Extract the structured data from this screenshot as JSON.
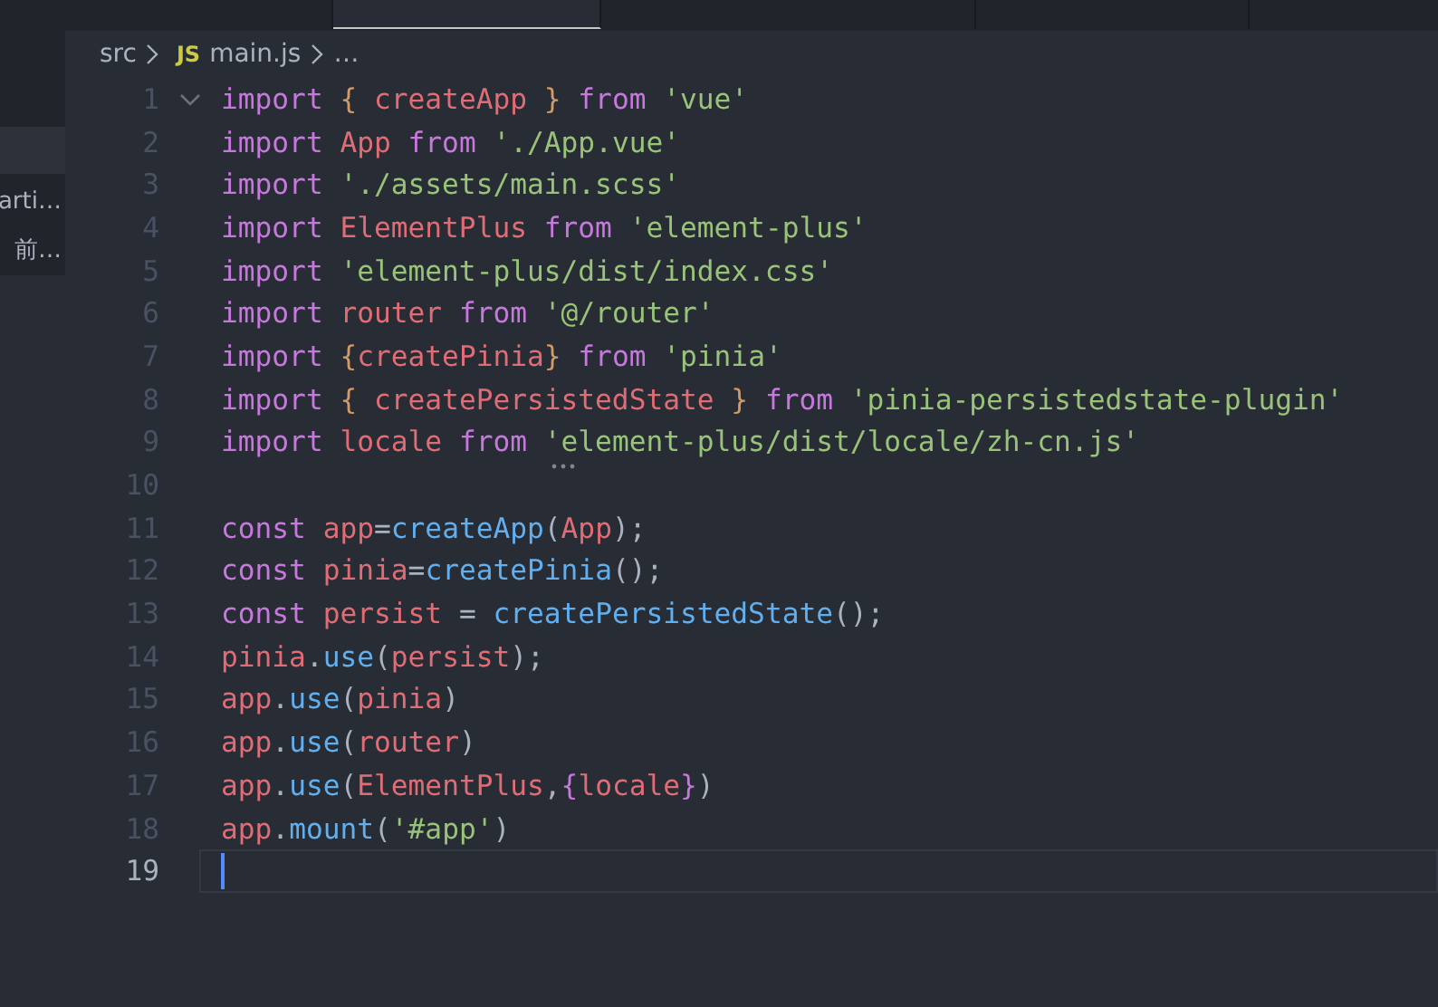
{
  "tabs": [
    {
      "selected": false
    },
    {
      "selected": true
    },
    {
      "selected": false
    },
    {
      "selected": false
    }
  ],
  "sidebar": {
    "items": [
      {
        "selected": true
      },
      {
        "label": "arti…",
        "selected": false
      },
      {
        "label": "前…",
        "selected": false
      }
    ]
  },
  "breadcrumb": {
    "folder": "src",
    "file_icon": "JS",
    "file": "main.js",
    "more": "…"
  },
  "editor": {
    "lines": [
      {
        "number": "1",
        "fold": true,
        "cursor": false,
        "tokens": [
          {
            "kind": "kw",
            "text": "import "
          },
          {
            "kind": "brace",
            "text": "{ "
          },
          {
            "kind": "var",
            "text": "createApp "
          },
          {
            "kind": "brace",
            "text": "} "
          },
          {
            "kind": "kw",
            "text": "from "
          },
          {
            "kind": "str",
            "text": "'vue'"
          }
        ]
      },
      {
        "number": "2",
        "fold": false,
        "cursor": false,
        "tokens": [
          {
            "kind": "kw",
            "text": "import "
          },
          {
            "kind": "var",
            "text": "App "
          },
          {
            "kind": "kw",
            "text": "from "
          },
          {
            "kind": "str",
            "text": "'./App.vue'"
          }
        ]
      },
      {
        "number": "3",
        "fold": false,
        "cursor": false,
        "tokens": [
          {
            "kind": "kw",
            "text": "import "
          },
          {
            "kind": "str",
            "text": "'./assets/main.scss'"
          }
        ]
      },
      {
        "number": "4",
        "fold": false,
        "cursor": false,
        "tokens": [
          {
            "kind": "kw",
            "text": "import "
          },
          {
            "kind": "var",
            "text": "ElementPlus "
          },
          {
            "kind": "kw",
            "text": "from "
          },
          {
            "kind": "str",
            "text": "'element-plus'"
          }
        ]
      },
      {
        "number": "5",
        "fold": false,
        "cursor": false,
        "tokens": [
          {
            "kind": "kw",
            "text": "import "
          },
          {
            "kind": "str",
            "text": "'element-plus/dist/index.css'"
          }
        ]
      },
      {
        "number": "6",
        "fold": false,
        "cursor": false,
        "tokens": [
          {
            "kind": "kw",
            "text": "import "
          },
          {
            "kind": "var",
            "text": "router "
          },
          {
            "kind": "kw",
            "text": "from "
          },
          {
            "kind": "str",
            "text": "'@/router'"
          }
        ]
      },
      {
        "number": "7",
        "fold": false,
        "cursor": false,
        "tokens": [
          {
            "kind": "kw",
            "text": "import "
          },
          {
            "kind": "brace",
            "text": "{"
          },
          {
            "kind": "var",
            "text": "createPinia"
          },
          {
            "kind": "brace",
            "text": "} "
          },
          {
            "kind": "kw",
            "text": "from "
          },
          {
            "kind": "str",
            "text": "'pinia'"
          }
        ]
      },
      {
        "number": "8",
        "fold": false,
        "cursor": false,
        "tokens": [
          {
            "kind": "kw",
            "text": "import "
          },
          {
            "kind": "brace",
            "text": "{ "
          },
          {
            "kind": "var",
            "text": "createPersistedState "
          },
          {
            "kind": "brace",
            "text": "} "
          },
          {
            "kind": "kw",
            "text": "from "
          },
          {
            "kind": "str",
            "text": "'pinia-persistedstate-plugin'"
          }
        ]
      },
      {
        "number": "9",
        "fold": false,
        "cursor": false,
        "tokens": [
          {
            "kind": "kw",
            "text": "import "
          },
          {
            "kind": "var",
            "text": "locale "
          },
          {
            "kind": "kw",
            "text": "from "
          },
          {
            "kind": "str",
            "text": "'element-plus/dist/locale/zh-cn.js'"
          }
        ]
      },
      {
        "number": "10",
        "fold": false,
        "cursor": false
      },
      {
        "number": "11",
        "fold": false,
        "cursor": false,
        "tokens": [
          {
            "kind": "kw",
            "text": "const "
          },
          {
            "kind": "var",
            "text": "app"
          },
          {
            "kind": "plain",
            "text": "="
          },
          {
            "kind": "fn",
            "text": "createApp"
          },
          {
            "kind": "plain",
            "text": "("
          },
          {
            "kind": "var",
            "text": "App"
          },
          {
            "kind": "plain",
            "text": ");"
          }
        ]
      },
      {
        "number": "12",
        "fold": false,
        "cursor": false,
        "tokens": [
          {
            "kind": "kw",
            "text": "const "
          },
          {
            "kind": "var",
            "text": "pinia"
          },
          {
            "kind": "plain",
            "text": "="
          },
          {
            "kind": "fn",
            "text": "createPinia"
          },
          {
            "kind": "plain",
            "text": "();"
          }
        ]
      },
      {
        "number": "13",
        "fold": false,
        "cursor": false,
        "tokens": [
          {
            "kind": "kw",
            "text": "const "
          },
          {
            "kind": "var",
            "text": "persist "
          },
          {
            "kind": "plain",
            "text": "= "
          },
          {
            "kind": "fn",
            "text": "createPersistedState"
          },
          {
            "kind": "plain",
            "text": "();"
          }
        ]
      },
      {
        "number": "14",
        "fold": false,
        "cursor": false,
        "tokens": [
          {
            "kind": "var",
            "text": "pinia"
          },
          {
            "kind": "plain",
            "text": "."
          },
          {
            "kind": "fn",
            "text": "use"
          },
          {
            "kind": "plain",
            "text": "("
          },
          {
            "kind": "var",
            "text": "persist"
          },
          {
            "kind": "plain",
            "text": ");"
          }
        ]
      },
      {
        "number": "15",
        "fold": false,
        "cursor": false,
        "tokens": [
          {
            "kind": "var",
            "text": "app"
          },
          {
            "kind": "plain",
            "text": "."
          },
          {
            "kind": "fn",
            "text": "use"
          },
          {
            "kind": "plain",
            "text": "("
          },
          {
            "kind": "var",
            "text": "pinia"
          },
          {
            "kind": "plain",
            "text": ")"
          }
        ]
      },
      {
        "number": "16",
        "fold": false,
        "cursor": false,
        "tokens": [
          {
            "kind": "var",
            "text": "app"
          },
          {
            "kind": "plain",
            "text": "."
          },
          {
            "kind": "fn",
            "text": "use"
          },
          {
            "kind": "plain",
            "text": "("
          },
          {
            "kind": "var",
            "text": "router"
          },
          {
            "kind": "plain",
            "text": ")"
          }
        ]
      },
      {
        "number": "17",
        "fold": false,
        "cursor": false,
        "tokens": [
          {
            "kind": "var",
            "text": "app"
          },
          {
            "kind": "plain",
            "text": "."
          },
          {
            "kind": "fn",
            "text": "use"
          },
          {
            "kind": "plain",
            "text": "("
          },
          {
            "kind": "var",
            "text": "ElementPlus"
          },
          {
            "kind": "plain",
            "text": ","
          },
          {
            "kind": "brace2",
            "text": "{"
          },
          {
            "kind": "var",
            "text": "locale"
          },
          {
            "kind": "brace2",
            "text": "}"
          },
          {
            "kind": "plain",
            "text": ")"
          }
        ]
      },
      {
        "number": "18",
        "fold": false,
        "cursor": false,
        "tokens": [
          {
            "kind": "var",
            "text": "app"
          },
          {
            "kind": "plain",
            "text": "."
          },
          {
            "kind": "fn",
            "text": "mount"
          },
          {
            "kind": "plain",
            "text": "("
          },
          {
            "kind": "str",
            "text": "'#app'"
          },
          {
            "kind": "plain",
            "text": ")"
          }
        ]
      },
      {
        "number": "19",
        "fold": false,
        "cursor": true
      }
    ]
  }
}
